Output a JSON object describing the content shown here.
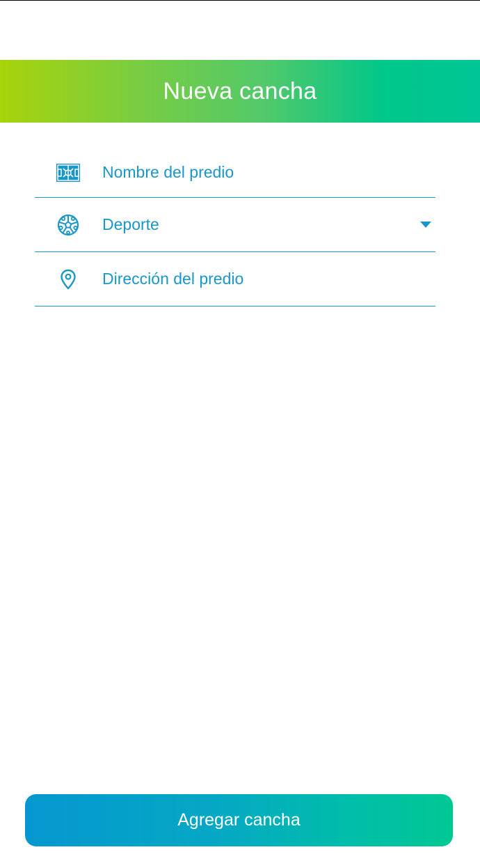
{
  "header": {
    "title": "Nueva cancha"
  },
  "form": {
    "name_field": {
      "placeholder": "Nombre del predio",
      "icon": "soccer-field-icon"
    },
    "sport_field": {
      "placeholder": "Deporte",
      "icon": "soccer-ball-icon",
      "dropdown_icon": "caret-down-icon"
    },
    "address_field": {
      "placeholder": "Dirección del predio",
      "icon": "location-pin-icon"
    }
  },
  "submit": {
    "label": "Agregar cancha"
  },
  "colors": {
    "accent_blue": "#1a96c8",
    "header_gradient_start": "#a8d40a",
    "header_gradient_end": "#00c696",
    "button_gradient_start": "#0598d0",
    "button_gradient_end": "#00c894"
  }
}
